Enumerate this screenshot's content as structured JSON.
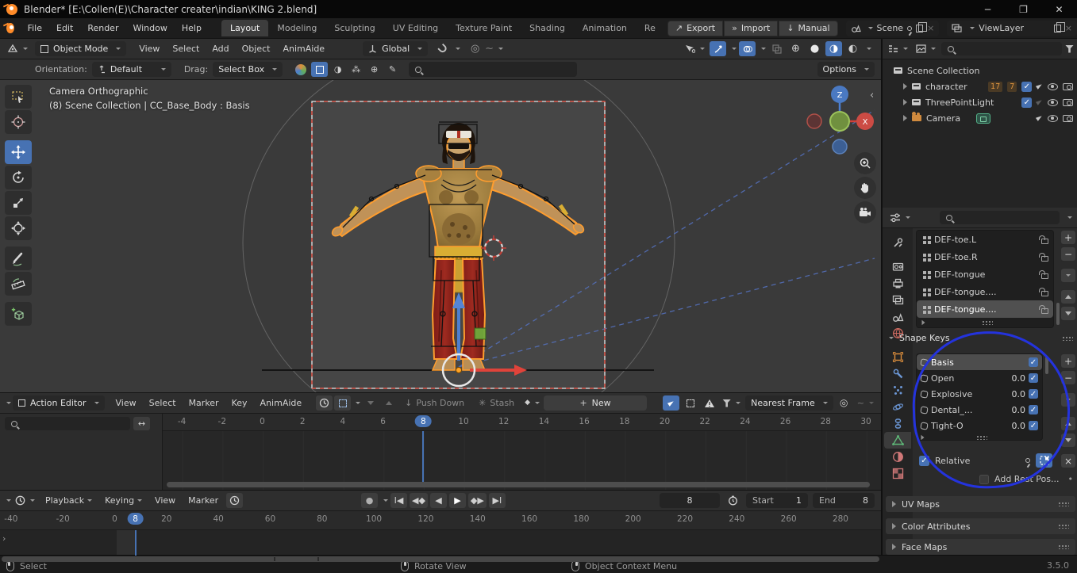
{
  "titlebar": {
    "title": "Blender* [E:\\Collen(E)\\Character creater\\indian\\KING 2.blend]"
  },
  "topbar": {
    "menus": [
      "File",
      "Edit",
      "Render",
      "Window",
      "Help"
    ],
    "workspaces": [
      {
        "label": "Layout",
        "active": true
      },
      {
        "label": "Modeling"
      },
      {
        "label": "Sculpting"
      },
      {
        "label": "UV Editing"
      },
      {
        "label": "Texture Paint"
      },
      {
        "label": "Shading"
      },
      {
        "label": "Animation"
      },
      {
        "label": "Re"
      }
    ],
    "actions": {
      "export": "Export",
      "import": "Import",
      "manual": "Manual"
    },
    "scene_value": "Scene",
    "view_layer_value": "ViewLayer"
  },
  "viewport_header": {
    "mode": "Object Mode",
    "menus": [
      "View",
      "Select",
      "Add",
      "Object",
      "AnimAide"
    ],
    "orientation": "Global"
  },
  "tool_settings": {
    "orientation_label": "Orientation:",
    "orientation_value": "Default",
    "drag_label": "Drag:",
    "drag_value": "Select Box",
    "options": "Options"
  },
  "viewport": {
    "overlay_line1": "Camera Orthographic",
    "overlay_line2": "(8) Scene Collection | CC_Base_Body : Basis",
    "axis_z": "Z",
    "axis_x": "X"
  },
  "outliner": {
    "root": "Scene Collection",
    "items": [
      {
        "name": "character",
        "badge1": "17",
        "badge2": "7"
      },
      {
        "name": "ThreePointLight"
      },
      {
        "name": "Camera"
      }
    ]
  },
  "properties": {
    "tabs": [
      "tool",
      "render",
      "output",
      "view-layer",
      "scene",
      "world",
      "object",
      "modifiers",
      "particles",
      "physics",
      "constraints",
      "object-data",
      "material",
      "texture"
    ],
    "active_tab": "object-data",
    "vertex_groups": {
      "rows": [
        {
          "name": "DEF-toe.L"
        },
        {
          "name": "DEF-toe.R"
        },
        {
          "name": "DEF-tongue"
        },
        {
          "name": "DEF-tongue...."
        },
        {
          "name": "DEF-tongue....",
          "selected": true
        }
      ]
    },
    "shape_keys": {
      "title": "Shape Keys",
      "rows": [
        {
          "name": "Basis",
          "value": "",
          "selected": true
        },
        {
          "name": "Open",
          "value": "0.0"
        },
        {
          "name": "Explosive",
          "value": "0.0"
        },
        {
          "name": "Dental_...",
          "value": "0.0"
        },
        {
          "name": "Tight-O",
          "value": "0.0"
        }
      ],
      "relative_label": "Relative",
      "add_rest_label": "Add Rest Pos..."
    },
    "panels": [
      "UV Maps",
      "Color Attributes",
      "Face Maps"
    ]
  },
  "dope_sheet": {
    "editor_label": "Action Editor",
    "menus": [
      "View",
      "Select",
      "Marker",
      "Key",
      "AnimAide"
    ],
    "push_down": "Push Down",
    "stash": "Stash",
    "new_button": "New",
    "snap_value": "Nearest Frame",
    "ruler": [
      -4,
      -2,
      0,
      2,
      4,
      6,
      8,
      10,
      12,
      14,
      16,
      18,
      20,
      22,
      24,
      26,
      28,
      30
    ],
    "current_frame": 8
  },
  "timeline": {
    "menus": [
      "Playback",
      "Keying",
      "View",
      "Marker"
    ],
    "frame_value": "8",
    "start_label": "Start",
    "start_value": "1",
    "end_label": "End",
    "end_value": "8",
    "ruler": [
      -40,
      -20,
      0,
      20,
      40,
      60,
      80,
      100,
      120,
      140,
      160,
      180,
      200,
      220,
      240,
      260,
      280
    ],
    "current_frame": 8
  },
  "statusbar": {
    "hint_left": "Select",
    "hint_middle": "Rotate View",
    "hint_right": "Object Context Menu",
    "version": "3.5.0"
  },
  "colors": {
    "accent": "#4772b3",
    "selection_outline": "#ff9d2e",
    "annotation": "#2433dd",
    "camera_border": "#ff5f51"
  },
  "icons": {
    "search": "magnifier",
    "filter": "funnel",
    "dropdown": "chevron-down",
    "checkbox": "check",
    "close": "×",
    "add": "+",
    "remove": "−",
    "lock": "open-padlock",
    "pin": "pin",
    "eye": "eye",
    "render-camera": "camera",
    "play": "▶",
    "record": "●"
  }
}
